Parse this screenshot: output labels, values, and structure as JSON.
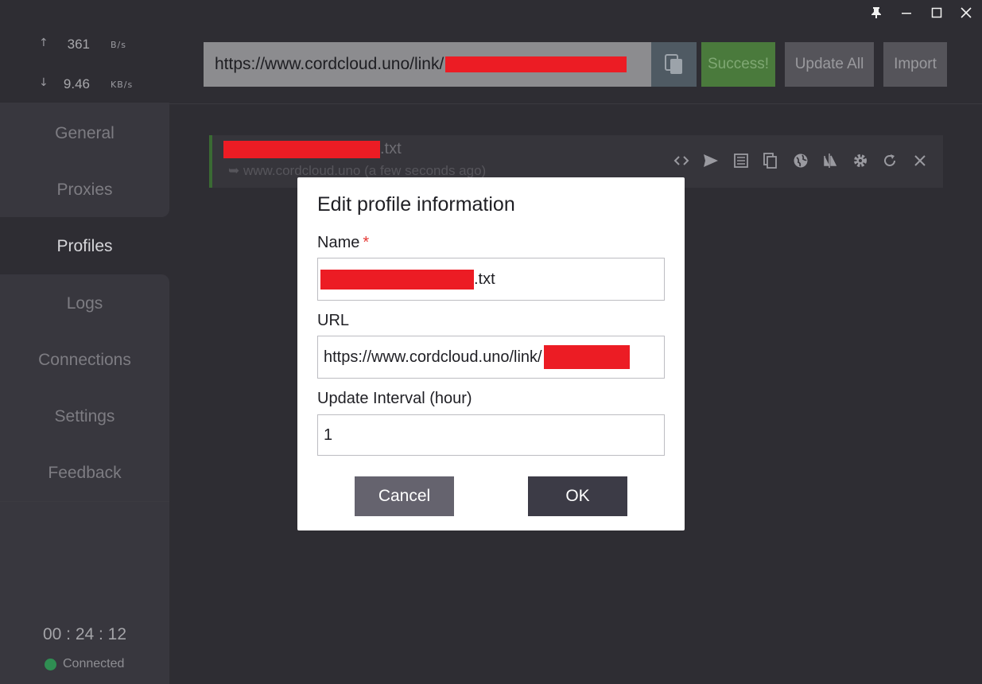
{
  "titlebar": {
    "pin_icon": "pin-icon",
    "minimize_icon": "minimize-icon",
    "maximize_icon": "maximize-icon",
    "close_icon": "close-icon"
  },
  "traffic": {
    "upload": {
      "arrow": "↑",
      "value": "361",
      "unit": "B/s"
    },
    "download": {
      "arrow": "↓",
      "value": "9.46",
      "unit": "KB/s"
    }
  },
  "sidebar": {
    "items": [
      {
        "label": "General"
      },
      {
        "label": "Proxies"
      },
      {
        "label": "Profiles"
      },
      {
        "label": "Logs"
      },
      {
        "label": "Connections"
      },
      {
        "label": "Settings"
      },
      {
        "label": "Feedback"
      }
    ],
    "active": "Profiles",
    "timer": "00 : 24 : 12",
    "status": "Connected",
    "status_color": "#2f8e52"
  },
  "toolbar": {
    "url_value": "https://www.cordcloud.uno/link/",
    "success_label": "Success!",
    "update_all_label": "Update All",
    "import_label": "Import"
  },
  "profile": {
    "name_suffix": ".txt",
    "subtitle": "➥ www.cordcloud.uno (a few seconds ago)",
    "accent_color": "#3a6a33"
  },
  "dialog": {
    "title": "Edit profile information",
    "name_label": "Name",
    "required_mark": "*",
    "name_value_suffix": ".txt",
    "url_label": "URL",
    "url_value": "https://www.cordcloud.uno/link/",
    "interval_label": "Update Interval (hour)",
    "interval_value": "1",
    "cancel_label": "Cancel",
    "ok_label": "OK"
  },
  "colors": {
    "background": "#2e2d33",
    "redaction": "#ec1c24",
    "success_button": "#4a7a3c"
  }
}
